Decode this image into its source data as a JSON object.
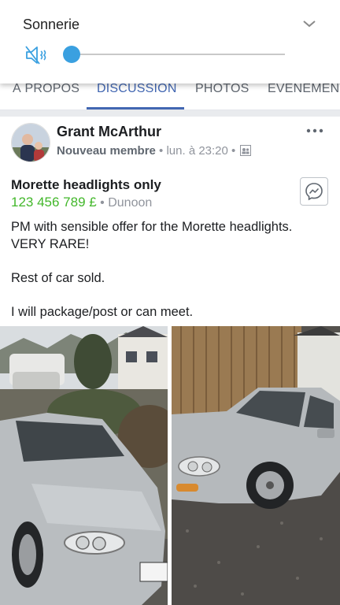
{
  "volume": {
    "title": "Sonnerie",
    "level": 0.0,
    "icon": "speaker-muted-icon",
    "accent": "#3aa0e0"
  },
  "tabs": [
    {
      "label": "À PROPOS",
      "active": false
    },
    {
      "label": "DISCUSSION",
      "active": true
    },
    {
      "label": "PHOTOS",
      "active": false
    },
    {
      "label": "ÉVÉNEMENT",
      "active": false
    }
  ],
  "post": {
    "author": "Grant McArthur",
    "badge": "Nouveau membre",
    "time": "lun. à 23:20",
    "privacy_icon": "group-icon",
    "title": "Morette headlights only",
    "price": "123 456 789 £",
    "location": "Dunoon",
    "body": [
      "PM with sensible offer for the Morette headlights. VERY RARE!",
      "Rest of car sold.",
      "I will package/post or can meet."
    ],
    "photos": [
      "car-front-photo",
      "car-side-photo"
    ]
  },
  "colors": {
    "brand": "#4267b2",
    "price": "#42b72a",
    "muted": "#90949c"
  }
}
